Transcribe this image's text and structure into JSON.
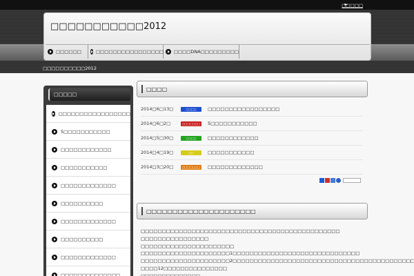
{
  "topbar": {
    "sitemap_label": "□□□□□"
  },
  "header": {
    "site_title": "□□□□□□□□□□□2012",
    "nav": [
      {
        "label": "□□□□□□"
      },
      {
        "label": "□□□□□□□□□□□□□□□□"
      },
      {
        "label": "□□□□DNA□□□□□□□□□"
      }
    ]
  },
  "breadcrumb": "□□□□□□□□□□2012",
  "sidebar": {
    "heading": "□□□□□",
    "items": [
      {
        "label": "□□□□□□□□□□□□□□□□□"
      },
      {
        "label": "5□□□□□□□□□□□"
      },
      {
        "label": "□□□□□□□□□□□□"
      },
      {
        "label": "□□□□□□□□□□□"
      },
      {
        "label": "□□□□□□□□□□□□□"
      },
      {
        "label": "□□□□□□□□□□"
      },
      {
        "label": "□□□□□□□□□□□□□"
      },
      {
        "label": "□□□□□□□□□□"
      },
      {
        "label": "□□□□□□□□□□□□□"
      },
      {
        "label": "□□□□□□□□□□□□□□"
      }
    ]
  },
  "news": {
    "heading": "□□□□",
    "rows": [
      {
        "date": "2014□6□13□",
        "badge": "□□□□",
        "badge_color": "#1f4fd1",
        "title": "□□□□□□□□□□□□□□□□□"
      },
      {
        "date": "2014□6□2□",
        "badge": "□□□□□□□",
        "badge_color": "#c81e1e",
        "title": "5□□□□□□□□□□□"
      },
      {
        "date": "2014□5□30□",
        "badge": "□□□□",
        "badge_color": "#22a31f",
        "title": "□□□□□□□□□□□□"
      },
      {
        "date": "2014□4□19□",
        "badge": "□□",
        "badge_color": "#d6cc1a",
        "title": "□□□□□□□□□□□"
      },
      {
        "date": "2014□3□20□",
        "badge": "□□□□□□□",
        "badge_color": "#e07a10",
        "title": "□□□□□□□□□□□□□"
      }
    ]
  },
  "share_icons": [
    {
      "icon": "hatena-icon",
      "color": "#1d5bd6"
    },
    {
      "icon": "livedoor-icon",
      "color": "#d0302a"
    },
    {
      "icon": "bookmark-icon",
      "color": "#4a7ad8"
    },
    {
      "icon": "delicious-icon",
      "color": "#2d5fc9"
    }
  ],
  "article": {
    "heading": "□□□□□□□□□□□□□□□□□□□□□",
    "lines": [
      "□□□□□□□□□□□□□□□□□□□□□□□□□□□□□□□□□□□□□□□□□□□□□□□",
      "□□□□□□□□□□□□□□□□",
      "□□□□□□□□□□□□□□□□□□□□□□",
      "□□□□□□□□□□□□□□□□□□□□□1□□□□□□□□□□□□□□□□□□□□□□□□□□□□□□",
      "□□□□□□□□□□□□□□□□□□□□□2□□□□□□□□□□□□□□□□□□□□□□□□□□□□□□□□□□□□□□□□□□□□",
      "□□□□12□□□□□□□□□□□□□□□",
      "□□□□□□□□□□□□□□"
    ]
  }
}
